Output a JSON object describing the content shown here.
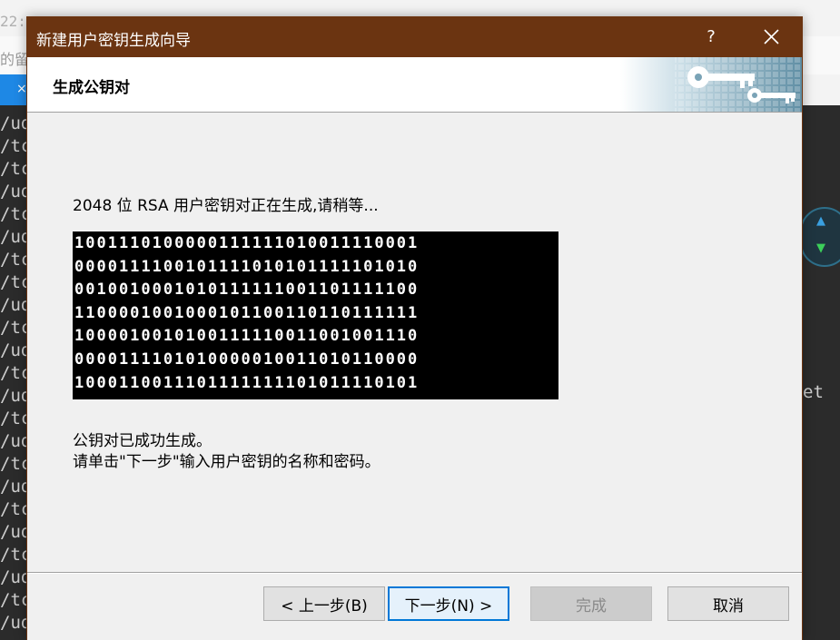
{
  "background": {
    "top_ghost_text": "22:",
    "strip_ghost_text": "的留",
    "tab_close_glyph": "×",
    "terminal_lines": [
      "/ud",
      "/tc",
      "/tc",
      "/ud",
      "/tc",
      "/ud",
      "/tc",
      "/tc",
      "/ud",
      "/tc",
      "/ud",
      "/tc",
      "/ud",
      "/tc",
      "/ud",
      "/tc",
      "/ud",
      "/tc",
      "/ud",
      "/tc",
      "/ud",
      "/tc",
      "/ud"
    ],
    "terminal_right_text": "et"
  },
  "dialog": {
    "title": "新建用户密钥生成向导",
    "help_label": "?",
    "step_title": "生成公钥对",
    "status_text": "2048 位 RSA 用户密钥对正在生成,请稍等...",
    "bit_rows": [
      "1001110100000111111010011110001",
      "0000111100101111010101111101010",
      "0010010001010111111001101111100",
      "1100001001000101100110110111111",
      "1000010010100111110011001001110",
      "0000111101010000010011010110000",
      "1000110011101111111101011110101"
    ],
    "done_line1": "公钥对已成功生成。",
    "done_line2": "请单击\"下一步\"输入用户密钥的名称和密码。",
    "buttons": {
      "back": "< 上一步(B)",
      "next": "下一步(N) >",
      "finish": "完成",
      "cancel": "取消"
    }
  },
  "colors": {
    "titlebar": "#6b3411",
    "accent": "#0078d7",
    "terminal_bg": "#2b2b2b"
  }
}
